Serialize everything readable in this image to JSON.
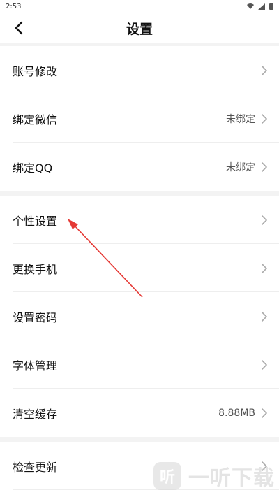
{
  "status_bar": {
    "time": "2:53"
  },
  "header": {
    "title": "设置"
  },
  "groups": [
    {
      "items": [
        {
          "label": "账号修改",
          "value": ""
        },
        {
          "label": "绑定微信",
          "value": "未绑定"
        },
        {
          "label": "绑定QQ",
          "value": "未绑定"
        }
      ]
    },
    {
      "items": [
        {
          "label": "个性设置",
          "value": ""
        },
        {
          "label": "更换手机",
          "value": ""
        },
        {
          "label": "设置密码",
          "value": ""
        },
        {
          "label": "字体管理",
          "value": ""
        },
        {
          "label": "清空缓存",
          "value": "8.88MB"
        }
      ]
    },
    {
      "items": [
        {
          "label": "检查更新",
          "value": ""
        }
      ]
    }
  ],
  "annotation": {
    "arrow_color": "#e53935"
  },
  "watermark": {
    "text": "一听下载",
    "logo_glyph": "听"
  }
}
